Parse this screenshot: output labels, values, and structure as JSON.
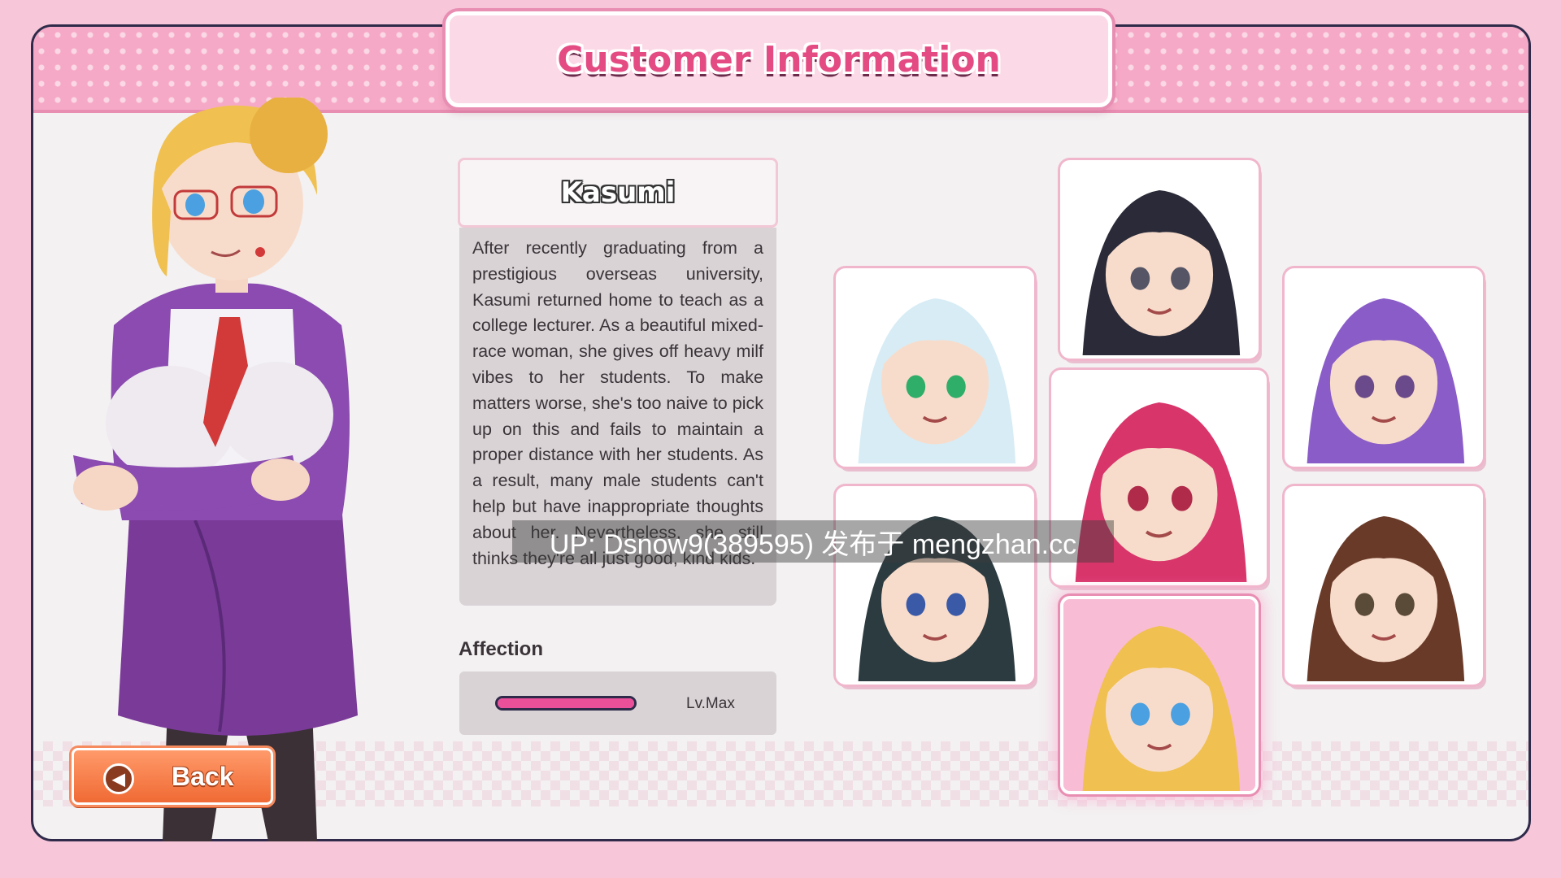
{
  "header": {
    "title": "Customer Information"
  },
  "character": {
    "name": "Kasumi",
    "description": "After recently graduating from a prestigious overseas university, Kasumi returned home to teach as a college lecturer. As a beautiful mixed-race woman, she gives off heavy milf vibes to her students. To make matters worse, she's too naive to pick up on this and fails to maintain a proper distance with her students. As a result, many male students can't help but have inappropriate thoughts about her. Nevertheless, she still thinks they're all just good, kind kids."
  },
  "affection": {
    "label": "Affection",
    "level_text": "Lv.Max",
    "fill_percent": 100,
    "fill_color": "#ea4f9a"
  },
  "portraits": [
    {
      "id": "white-hair",
      "hair": "#d7ecf5",
      "eye": "#2fae6a",
      "selected": false
    },
    {
      "id": "police",
      "hair": "#2a2a38",
      "eye": "#555565",
      "selected": false
    },
    {
      "id": "purple-hair",
      "hair": "#8a5cc8",
      "eye": "#6a4a8a",
      "selected": false
    },
    {
      "id": "maid",
      "hair": "#d8356b",
      "eye": "#b02a4a",
      "selected": false
    },
    {
      "id": "dark-teal",
      "hair": "#2c3b40",
      "eye": "#3a5aa8",
      "selected": false
    },
    {
      "id": "brown-glasses",
      "hair": "#6a3a28",
      "eye": "#5a4a38",
      "selected": false
    },
    {
      "id": "kasumi",
      "hair": "#f0c050",
      "eye": "#4aa0e0",
      "selected": true
    }
  ],
  "buttons": {
    "back": "Back"
  },
  "watermark": "UP: Dsnow9(389595) 发布于 mengzhan.cc"
}
